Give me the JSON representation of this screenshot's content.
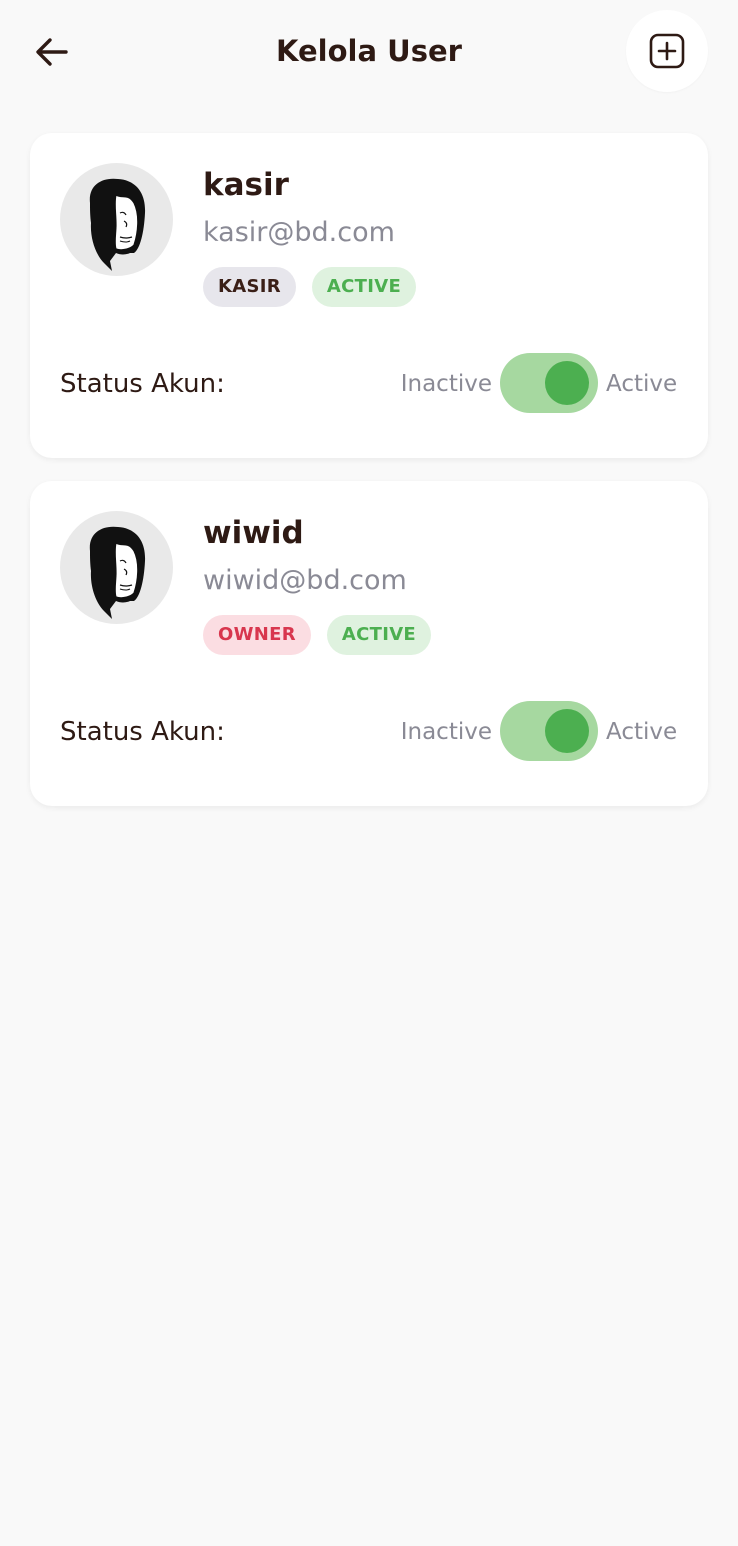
{
  "header": {
    "title": "Kelola User",
    "back_icon": "arrow-left-icon",
    "add_icon": "plus-square-icon"
  },
  "users": [
    {
      "name": "kasir",
      "email": "kasir@bd.com",
      "role_badge": "KASIR",
      "status_badge": "ACTIVE",
      "status_label": "Status Akun:",
      "toggle_off_label": "Inactive",
      "toggle_on_label": "Active",
      "toggle_on": true
    },
    {
      "name": "wiwid",
      "email": "wiwid@bd.com",
      "role_badge": "OWNER",
      "status_badge": "ACTIVE",
      "status_label": "Status Akun:",
      "toggle_off_label": "Inactive",
      "toggle_on_label": "Active",
      "toggle_on": true
    }
  ],
  "colors": {
    "text_primary": "#2e1a14",
    "text_secondary": "#8a8a95",
    "active_green": "#4caf50",
    "toggle_track": "#a6d8a0",
    "owner_red": "#d8364e"
  }
}
